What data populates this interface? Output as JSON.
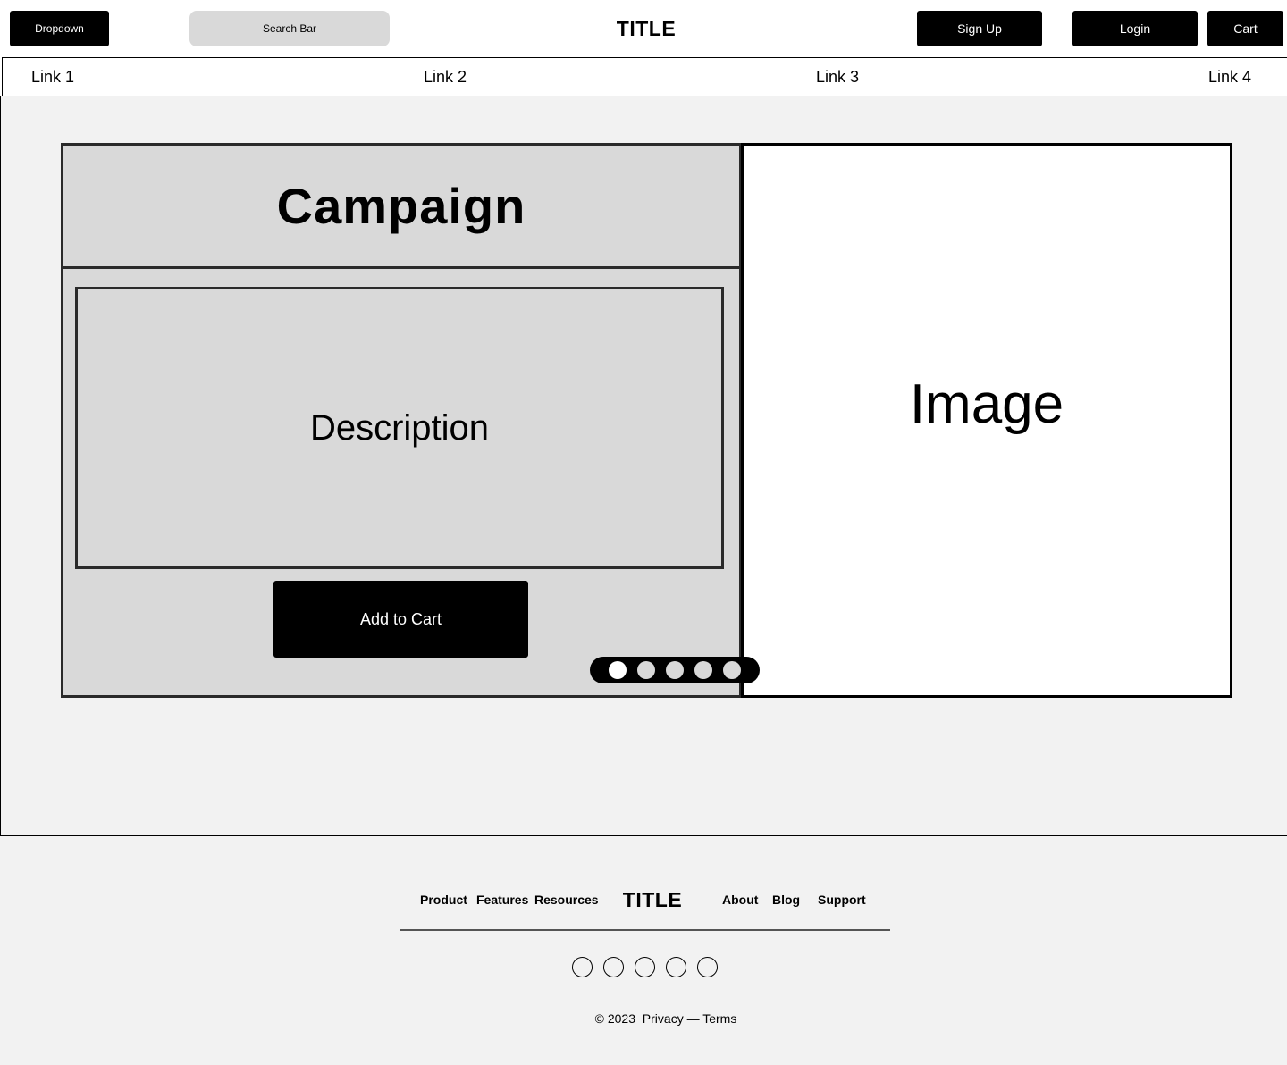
{
  "header": {
    "dropdown_label": "Dropdown",
    "search_placeholder": "Search Bar",
    "title": "TITLE",
    "signup_label": "Sign Up",
    "login_label": "Login",
    "cart_label": "Cart"
  },
  "nav": {
    "links": [
      {
        "label": "Link 1"
      },
      {
        "label": "Link 2"
      },
      {
        "label": "Link 3"
      },
      {
        "label": "Link 4"
      }
    ]
  },
  "campaign": {
    "title": "Campaign",
    "description": "Description",
    "add_to_cart_label": "Add to Cart",
    "image_label": "Image",
    "carousel": {
      "count": 5,
      "active": 1
    }
  },
  "footer": {
    "links_left": [
      {
        "label": "Product"
      },
      {
        "label": "Features"
      },
      {
        "label": "Resources"
      }
    ],
    "title": "TITLE",
    "links_right": [
      {
        "label": "About"
      },
      {
        "label": "Blog"
      },
      {
        "label": "Support"
      }
    ],
    "social_icon_count": 5,
    "copyright": "© 2023",
    "legal": "Privacy — Terms"
  },
  "colors": {
    "black": "#000000",
    "panel_gray": "#d9d9d9",
    "page_gray": "#f2f2f2",
    "white": "#ffffff"
  }
}
